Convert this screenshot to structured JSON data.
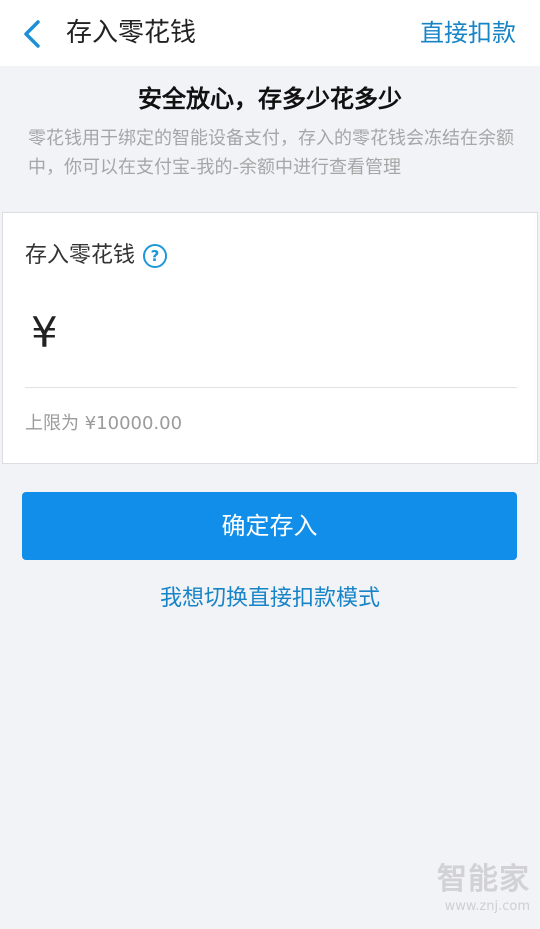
{
  "header": {
    "title": "存入零花钱",
    "action_label": "直接扣款"
  },
  "intro": {
    "title": "安全放心，存多少花多少",
    "description": "零花钱用于绑定的智能设备支付，存入的零花钱会冻结在余额中，你可以在支付宝-我的-余额中进行查看管理"
  },
  "card": {
    "label": "存入零花钱",
    "help_icon_glyph": "?",
    "currency_symbol": "¥",
    "amount_value": "",
    "amount_placeholder": "",
    "limit_text": "上限为 ¥10000.00"
  },
  "buttons": {
    "confirm_label": "确定存入",
    "switch_mode_label": "我想切换直接扣款模式"
  },
  "watermark": {
    "logo_text": "智能家",
    "url_text": "www.znj.com"
  },
  "colors": {
    "accent": "#108ee9",
    "link": "#1784c7",
    "background": "#f2f3f7"
  },
  "icons": {
    "back": "chevron-left-icon",
    "help": "question-circle-icon"
  }
}
